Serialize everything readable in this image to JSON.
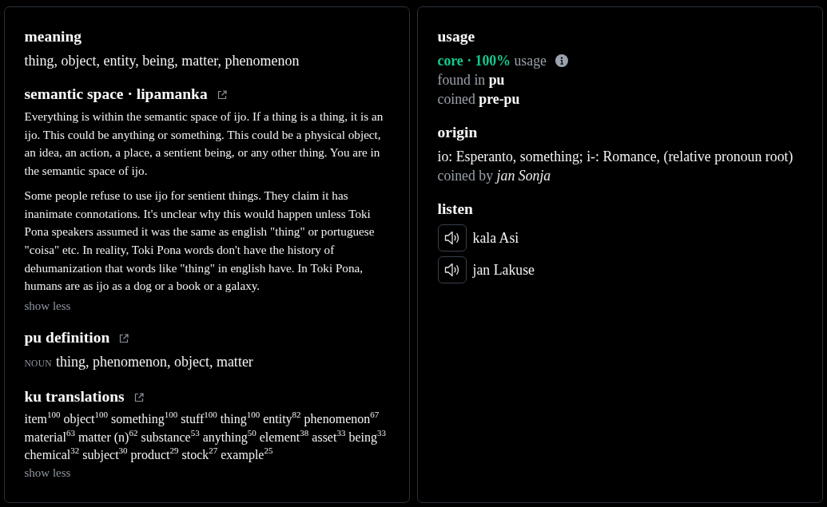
{
  "definition_panel": {
    "sections": [
      {
        "kind": "text",
        "heading": "meaning",
        "external_link": false,
        "text": "thing, object, entity, being, matter, phenomenon"
      },
      {
        "kind": "paragraphs",
        "heading": "semantic space · lipamanka",
        "external_link": true,
        "paragraphs": [
          "Everything is within the semantic space of ijo. If a thing is a thing, it is an ijo. This could be anything or something. This could be a physical object, an idea, an action, a place, a sentient being, or any other thing. You are in the semantic space of ijo.",
          "Some people refuse to use ijo for sentient things. They claim it has inanimate connotations. It's unclear why this would happen unless Toki Pona speakers assumed it was the same as english \"thing\" or portuguese \"coisa\" etc. In reality, Toki Pona words don't have the history of dehumanization that words like \"thing\" in english have. In Toki Pona, humans are as ijo as a dog or a book or a galaxy."
        ],
        "toggle": "show less"
      },
      {
        "kind": "definition",
        "heading": "pu definition",
        "external_link": true,
        "part_of_speech": "NOUN",
        "text": "thing, phenomenon, object, matter"
      },
      {
        "kind": "translations",
        "heading": "ku translations",
        "external_link": true,
        "translations": [
          {
            "word": "item",
            "score": "100"
          },
          {
            "word": "object",
            "score": "100"
          },
          {
            "word": "something",
            "score": "100"
          },
          {
            "word": "stuff",
            "score": "100"
          },
          {
            "word": "thing",
            "score": "100"
          },
          {
            "word": "entity",
            "score": "82"
          },
          {
            "word": "phenomenon",
            "score": "67"
          },
          {
            "word": "material",
            "score": "63"
          },
          {
            "word": "matter (n)",
            "score": "62"
          },
          {
            "word": "substance",
            "score": "53"
          },
          {
            "word": "anything",
            "score": "50"
          },
          {
            "word": "element",
            "score": "38"
          },
          {
            "word": "asset",
            "score": "33"
          },
          {
            "word": "being",
            "score": "33"
          },
          {
            "word": "chemical",
            "score": "32"
          },
          {
            "word": "subject",
            "score": "30"
          },
          {
            "word": "product",
            "score": "29"
          },
          {
            "word": "stock",
            "score": "27"
          },
          {
            "word": "example",
            "score": "25"
          }
        ],
        "toggle": "show less"
      }
    ]
  },
  "details_panel": {
    "usage": {
      "heading": "usage",
      "summary": "**core · 100%** usage",
      "found_in": "found in **pu**",
      "coined": "coined **pre-pu**"
    },
    "origin": {
      "heading": "origin",
      "text": "io: Esperanto, something; i-: Romance, (relative pronoun root)",
      "coined_by": "coined by *jan Sonja*"
    },
    "listen": {
      "heading": "listen",
      "recordings": [
        {
          "speaker": "kala Asi"
        },
        {
          "speaker": "jan Lakuse"
        }
      ]
    }
  }
}
